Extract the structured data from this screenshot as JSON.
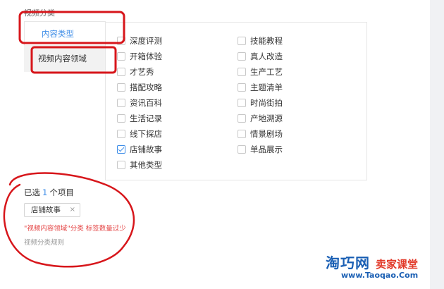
{
  "section_title": "视频分类",
  "tabs": [
    {
      "label": "内容类型",
      "active": true
    },
    {
      "label": "视频内容领域",
      "active": false
    }
  ],
  "options": [
    {
      "label": "深度评测",
      "checked": false
    },
    {
      "label": "开箱体验",
      "checked": false
    },
    {
      "label": "才艺秀",
      "checked": false
    },
    {
      "label": "搭配攻略",
      "checked": false
    },
    {
      "label": "资讯百科",
      "checked": false
    },
    {
      "label": "生活记录",
      "checked": false
    },
    {
      "label": "线下探店",
      "checked": false
    },
    {
      "label": "店铺故事",
      "checked": true
    },
    {
      "label": "其他类型",
      "checked": false
    },
    {
      "label": "技能教程",
      "checked": false
    },
    {
      "label": "真人改造",
      "checked": false
    },
    {
      "label": "生产工艺",
      "checked": false
    },
    {
      "label": "主题清单",
      "checked": false
    },
    {
      "label": "时尚街拍",
      "checked": false
    },
    {
      "label": "产地溯源",
      "checked": false
    },
    {
      "label": "情景剧场",
      "checked": false
    },
    {
      "label": "单品展示",
      "checked": false
    }
  ],
  "summary": {
    "prefix": "已选",
    "count": "1",
    "suffix": "个项目"
  },
  "selected_tag": {
    "label": "店铺故事",
    "remove": "×"
  },
  "error_text": "\"视频内容领域\"分类 标签数量过少",
  "rules_link": "视频分类规则",
  "watermark": {
    "main": "淘巧网",
    "sub": "卖家课堂",
    "site": "www.Taoqao.Com"
  },
  "colors": {
    "accent": "#3c8ce7",
    "error": "#e44545",
    "annotation": "#d7161b"
  }
}
